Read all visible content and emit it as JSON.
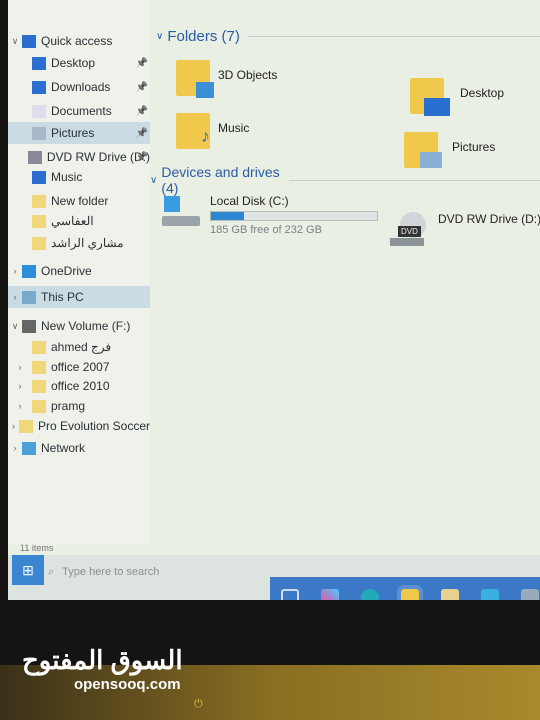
{
  "sidebar": {
    "items": [
      {
        "label": "Quick access",
        "icon": "star-icon"
      },
      {
        "label": "Desktop",
        "icon": "desktop-icon",
        "pinned": true
      },
      {
        "label": "Downloads",
        "icon": "download-icon",
        "pinned": true
      },
      {
        "label": "Documents",
        "icon": "documents-icon",
        "pinned": true
      },
      {
        "label": "Pictures",
        "icon": "pictures-icon",
        "pinned": true,
        "selected": true
      },
      {
        "label": "DVD RW Drive (D:)",
        "icon": "dvd-icon",
        "pinned": true
      },
      {
        "label": "Music",
        "icon": "music-icon"
      },
      {
        "label": "New folder",
        "icon": "folder-icon"
      },
      {
        "label": "العفاسي",
        "icon": "folder-icon"
      },
      {
        "label": "مشاري الراشد",
        "icon": "folder-icon"
      },
      {
        "label": "OneDrive",
        "icon": "cloud-icon"
      },
      {
        "label": "This PC",
        "icon": "computer-icon"
      },
      {
        "label": "New Volume (F:)",
        "icon": "drive-icon"
      },
      {
        "label": "ahmed فرج",
        "icon": "folder-icon"
      },
      {
        "label": "office 2007",
        "icon": "folder-icon"
      },
      {
        "label": "office 2010",
        "icon": "folder-icon"
      },
      {
        "label": "pramg",
        "icon": "folder-icon"
      },
      {
        "label": "Pro Evolution Soccer",
        "icon": "folder-icon"
      },
      {
        "label": "Network",
        "icon": "network-icon"
      }
    ]
  },
  "main": {
    "folders_header": "Folders (7)",
    "folders": [
      "3D Objects",
      "Desktop",
      "Music",
      "Pictures"
    ],
    "drives_header": "Devices and drives (4)",
    "drives": [
      {
        "name": "Local Disk (C:)",
        "free": "185 GB free of 232 GB",
        "used_percent": 20
      },
      {
        "name": "DVD RW Drive (D:)",
        "badge": "DVD"
      }
    ]
  },
  "status": "11 items",
  "taskbar": {
    "search_placeholder": "Type here to search"
  },
  "watermark": {
    "arabic": "السوق المفتوح",
    "latin": "opensooq.com"
  },
  "colors": {
    "accent": "#2e86cf",
    "taskbar": "#3b79c6"
  }
}
